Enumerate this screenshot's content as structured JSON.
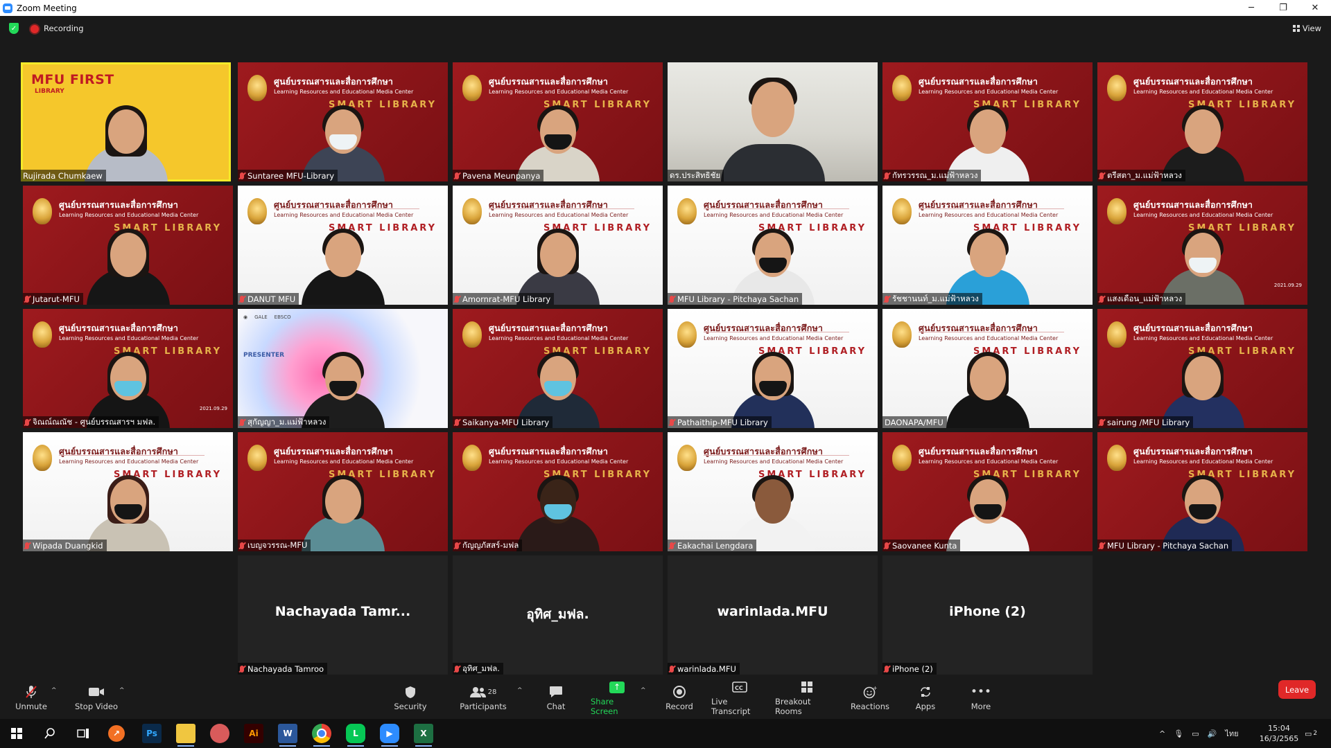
{
  "window": {
    "title": "Zoom Meeting",
    "minimize": "─",
    "restore": "❐",
    "close": "✕"
  },
  "meeting": {
    "recording_label": "Recording",
    "view_label": "View"
  },
  "banner": {
    "thai": "ศูนย์บรรณสารและสื่อการศึกษา",
    "english": "Learning Resources and Educational Media Center",
    "smart": "SMART LIBRARY",
    "date": "2021.09.29"
  },
  "mfu_first": {
    "title": "MFU FIRST",
    "sub": "LIBRARY"
  },
  "presenter_tile": {
    "label": "PRESENTER"
  },
  "participants": [
    {
      "name": "Rujirada Chumkaew"
    },
    {
      "name": "Suntaree MFU-Library"
    },
    {
      "name": "Pavena Meunpanya"
    },
    {
      "name": "ดร.ประสิทธิชัย"
    },
    {
      "name": "กัทรวรรณ_ม.แม่ฟ้าหลวง"
    },
    {
      "name": "ตรีสตา_ม.แม่ฟ้าหลวง"
    },
    {
      "name": "Jutarut-MFU"
    },
    {
      "name": "DANUT MFU"
    },
    {
      "name": "Amornrat-MFU Library"
    },
    {
      "name": "MFU Library - Pitchaya Sachan"
    },
    {
      "name": "รัชชานนท์_ม.แม่ฟ้าหลวง"
    },
    {
      "name": "แสงเดือน_แม่ฟ้าหลวง"
    },
    {
      "name": "จิณณ์ณณัช - ศูนย์บรรณสารฯ มฟล."
    },
    {
      "name": "สุกัญญา_ม.แม่ฟ้าหลวง"
    },
    {
      "name": "Saikanya-MFU Library"
    },
    {
      "name": "Pathaithip-MFU Library"
    },
    {
      "name": "DAONAPA/MFU"
    },
    {
      "name": "sairung /MFU Library"
    },
    {
      "name": "Wipada Duangkid"
    },
    {
      "name": "เบญจวรรณ-MFU"
    },
    {
      "name": "กัญญภัสสร์-มฟล"
    },
    {
      "name": "Eakachai Lengdara"
    },
    {
      "name": "Saovanee Kunta"
    },
    {
      "name": "MFU Library - Pitchaya Sachan"
    },
    {
      "name": "Nachayada Tamroo",
      "display": "Nachayada Tamr..."
    },
    {
      "name": "อุทิศ_มฟล.",
      "display": "อุทิศ_มฟล."
    },
    {
      "name": "warinlada.MFU",
      "display": "warinlada.MFU"
    },
    {
      "name": "iPhone (2)",
      "display": "iPhone (2)"
    }
  ],
  "toolbar": {
    "unmute": "Unmute",
    "stop_video": "Stop Video",
    "security": "Security",
    "participants": "Participants",
    "participants_count": "28",
    "chat": "Chat",
    "share_screen": "Share Screen",
    "record": "Record",
    "live_transcript": "Live Transcript",
    "breakout_rooms": "Breakout Rooms",
    "reactions": "Reactions",
    "apps": "Apps",
    "more": "More",
    "leave": "Leave"
  },
  "taskbar": {
    "time": "15:04",
    "date": "16/3/2565",
    "language": "ไทย",
    "notifications": "2",
    "apps": [
      "start",
      "search",
      "task-view",
      "postman",
      "photoshop",
      "file-explorer",
      "teams",
      "illustrator",
      "word",
      "chrome",
      "line",
      "zoom",
      "excel"
    ]
  },
  "colors": {
    "accent_green": "#23d959",
    "leave_red": "#e02828",
    "banner_red": "#9e1a1e",
    "active_speaker": "#f4ea29"
  }
}
